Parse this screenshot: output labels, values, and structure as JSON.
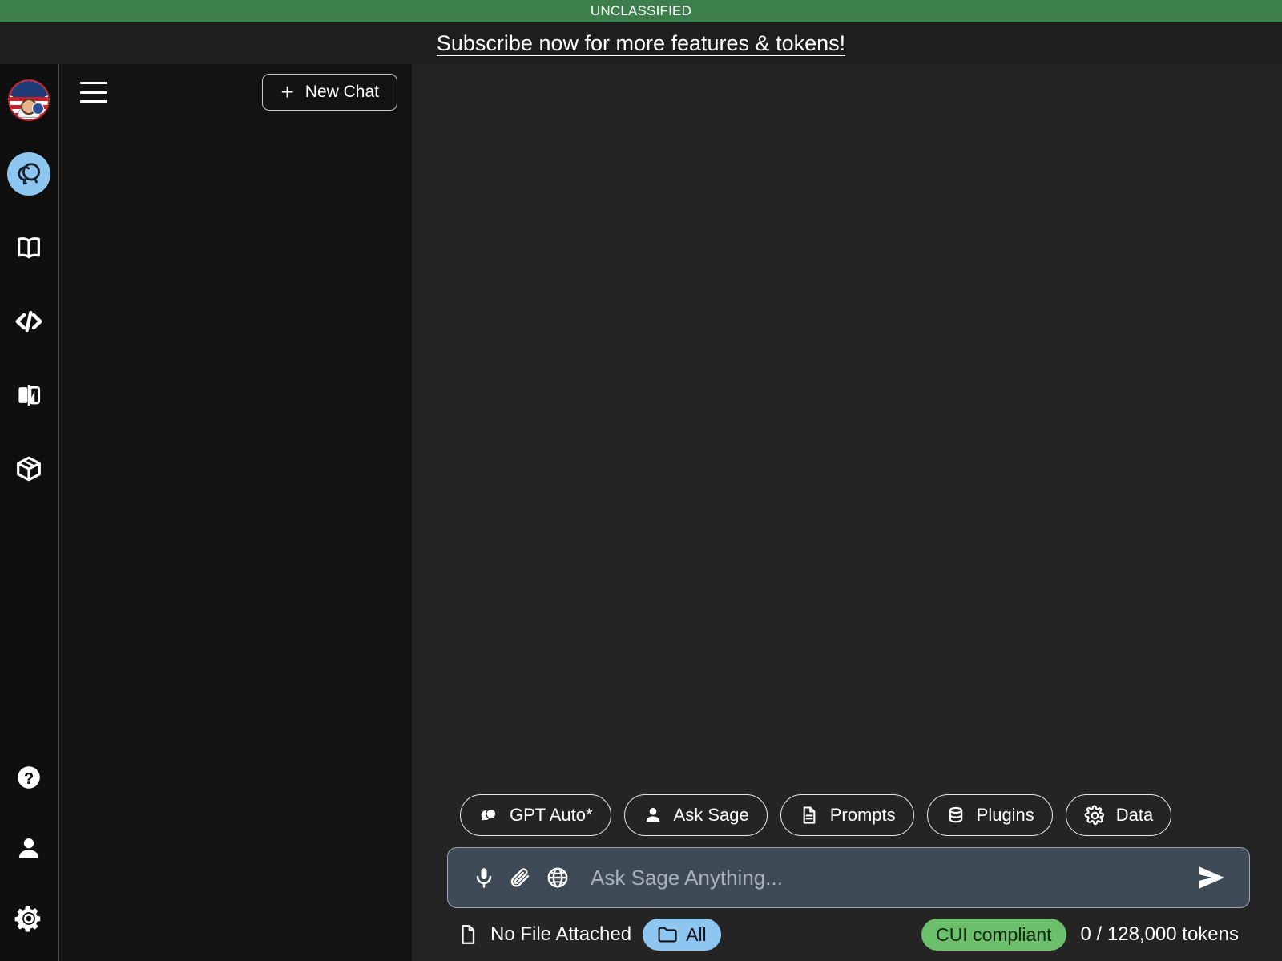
{
  "classification": {
    "label": "UNCLASSIFIED",
    "bar_color": "#3d7e4d"
  },
  "promo": {
    "link_text": "Subscribe now for more features & tokens!"
  },
  "rail": {
    "top_items": [
      {
        "name": "app-logo",
        "icon": "ask-sage-emblem-icon",
        "label": "Ask Sage",
        "active": false
      },
      {
        "name": "chat",
        "icon": "chat-bubbles-icon",
        "label": "Chat",
        "active": true
      },
      {
        "name": "library",
        "icon": "open-book-icon",
        "label": "Library",
        "active": false
      },
      {
        "name": "code",
        "icon": "code-brackets-icon",
        "label": "Code",
        "active": false
      },
      {
        "name": "compare",
        "icon": "compare-split-icon",
        "label": "Compare",
        "active": false
      },
      {
        "name": "models",
        "icon": "cube-box-icon",
        "label": "Models",
        "active": false
      }
    ],
    "bottom_items": [
      {
        "name": "help",
        "icon": "question-circle-icon",
        "label": "Help"
      },
      {
        "name": "account",
        "icon": "person-icon",
        "label": "Account"
      },
      {
        "name": "settings",
        "icon": "gear-icon",
        "label": "Settings"
      }
    ]
  },
  "sidebar": {
    "menu_icon": "hamburger-menu-icon",
    "new_chat_label": "New Chat",
    "new_chat_icon": "plus-icon",
    "conversations": []
  },
  "composer": {
    "tools": [
      {
        "label": "GPT Auto*",
        "icon": "chat-bubbles-filled-icon",
        "name": "model-selector"
      },
      {
        "label": "Ask Sage",
        "icon": "person-icon",
        "name": "persona-selector"
      },
      {
        "label": "Prompts",
        "icon": "document-icon",
        "name": "prompts-button"
      },
      {
        "label": "Plugins",
        "icon": "database-icon",
        "name": "plugins-button"
      },
      {
        "label": "Data",
        "icon": "gear-icon",
        "name": "data-button"
      }
    ],
    "input_placeholder": "Ask Sage Anything...",
    "input_value": "",
    "input_icons": [
      "microphone-icon",
      "paperclip-icon",
      "globe-icon"
    ],
    "send_icon": "send-arrow-icon",
    "input_bg": "#3f4a57"
  },
  "status": {
    "file_icon": "file-icon",
    "file_text": "No File Attached",
    "scope_pill": {
      "label": "All",
      "icon": "folder-icon",
      "color": "#8ec6f2"
    },
    "compliance_pill": {
      "label": "CUI compliant",
      "color": "#6cc06c"
    },
    "tokens_text": "0 / 128,000 tokens"
  }
}
